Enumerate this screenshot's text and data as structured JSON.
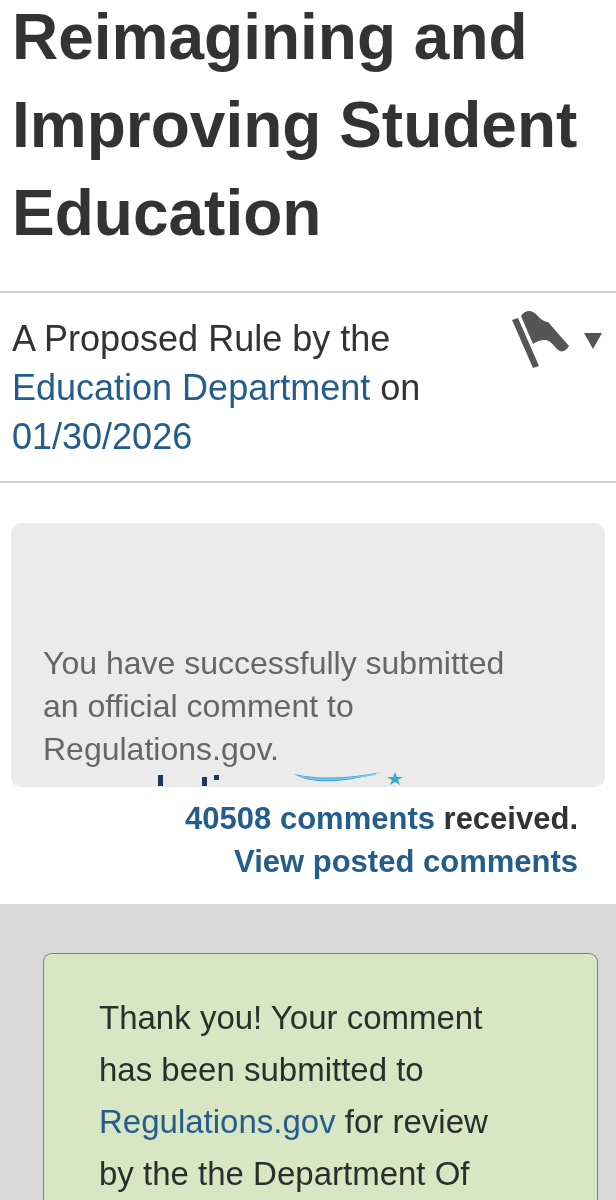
{
  "article": {
    "title": "Reimagining and Improving Student Education"
  },
  "byline": {
    "lead": "A Proposed Rule by the",
    "agency_link": "Education Department",
    "joiner": "on",
    "date_link": "01/30/2026"
  },
  "comment_status": {
    "message": "You have successfully submitted an official comment to Regulations.gov.",
    "count_link": "40508 comments",
    "count_suffix": "received.",
    "view_link": "View posted comments"
  },
  "confirmation": {
    "lead": "Thank you! Your comment has been submitted to",
    "link": "Regulations.gov",
    "tail": "for review by the the Department Of"
  }
}
